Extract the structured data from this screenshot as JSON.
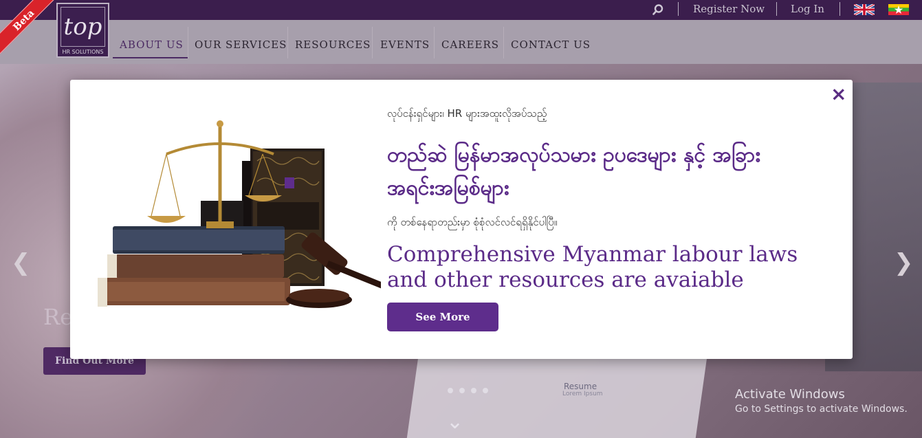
{
  "badge": {
    "label": "Beta"
  },
  "logo": {
    "text": "top",
    "subtitle": "HR SOLUTIONS"
  },
  "topbar": {
    "register_label": "Register Now",
    "login_label": "Log In",
    "search_icon": "search-icon",
    "languages": [
      "english-flag-icon",
      "myanmar-flag-icon"
    ]
  },
  "nav": {
    "items": [
      {
        "label": "ABOUT US",
        "active": true
      },
      {
        "label": "OUR SERVICES"
      },
      {
        "label": "RESOURCES"
      },
      {
        "label": "EVENTS"
      },
      {
        "label": "CAREERS"
      },
      {
        "label": "CONTACT US"
      }
    ]
  },
  "hero": {
    "heading": "Re",
    "button_label": "Find Out More",
    "resume_title": "Resume",
    "resume_subtitle": "Lorem Ipsum",
    "prev_icon": "chevron-left-icon",
    "next_icon": "chevron-right-icon",
    "dots": 4,
    "scroll_icon": "chevron-down-icon"
  },
  "modal": {
    "close_label": "×",
    "mm_line1": "လုပ်ငန်းရှင်များ၊ HR များအထူးလိုအပ်သည့်",
    "mm_headline": "တည်ဆဲ မြန်မာအလုပ်သမား ဥပဒေများ နှင့် အခြား အရင်းအမြစ်များ",
    "mm_line2": "ကို တစ်နေရာတည်းမှာ စုံစုံလင်လင်ရရှိနိုင်ပါပြီ။",
    "en_headline": "Comprehensive Myanmar labour laws and other resources are avaiable",
    "button_label": "See More",
    "accent_color": "#5b2b88"
  },
  "watermark": {
    "line1": "Activate Windows",
    "line2": "Go to Settings to activate Windows."
  }
}
